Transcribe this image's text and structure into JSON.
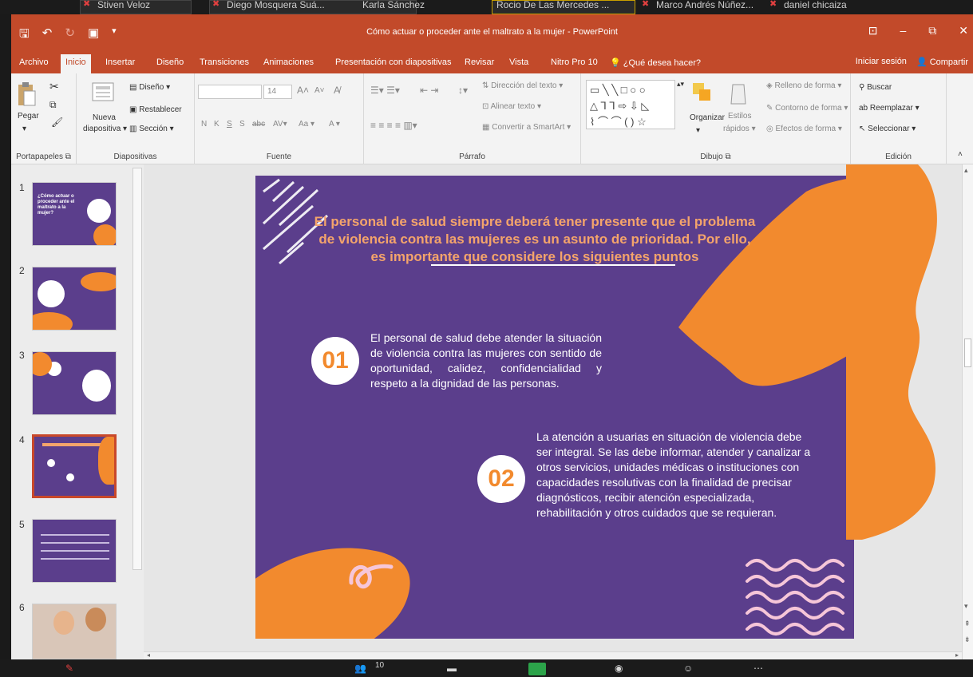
{
  "zoom": {
    "participants": [
      "Stiven Veloz",
      "Diego Mosquera Suá...",
      "Karla Sánchez",
      "Rocio De Las Mercedes ...",
      "Marco Andrés Núñez...",
      "daniel chicaiza"
    ],
    "participants_count": "10",
    "colors": {
      "bar": "#1b1b1b",
      "share": "#2ca44a"
    }
  },
  "window": {
    "title": "Cómo actuar o proceder ante el maltrato a la mujer - PowerPoint",
    "controls": [
      "⊡",
      "–",
      "⧉",
      "✕"
    ]
  },
  "tabs": [
    {
      "label": "Archivo"
    },
    {
      "label": "Inicio",
      "active": true
    },
    {
      "label": "Insertar"
    },
    {
      "label": "Diseño"
    },
    {
      "label": "Transiciones"
    },
    {
      "label": "Animaciones"
    },
    {
      "label": "Presentación con diapositivas"
    },
    {
      "label": "Revisar"
    },
    {
      "label": "Vista"
    },
    {
      "label": "Nitro Pro 10"
    },
    {
      "label": "¿Qué desea hacer?"
    }
  ],
  "account": {
    "signin": "Iniciar sesión",
    "share": "Compartir"
  },
  "ribbon": {
    "portapapeles": {
      "label": "Portapapeles",
      "paste": "Pegar"
    },
    "diapositivas": {
      "label": "Diapositivas",
      "new_slide_1": "Nueva",
      "new_slide_2": "diapositiva",
      "layout": "Diseño",
      "reset": "Restablecer",
      "section": "Sección"
    },
    "fuente": {
      "label": "Fuente",
      "size": "14",
      "bold": "N",
      "italic": "K",
      "underline": "S",
      "strike": "S",
      "spacing": "abc",
      "case": "Aa"
    },
    "parrafo": {
      "label": "Párrafo",
      "text_direction": "Dirección del texto",
      "align_text": "Alinear texto",
      "smartart": "Convertir a SmartArt"
    },
    "dibujo": {
      "label": "Dibujo",
      "arrange": "Organizar",
      "styles_1": "Estilos",
      "styles_2": "rápidos",
      "fill": "Relleno de forma",
      "outline": "Contorno de forma",
      "effects": "Efectos de forma"
    },
    "edicion": {
      "label": "Edición",
      "find": "Buscar",
      "replace": "Reemplazar",
      "select": "Seleccionar"
    }
  },
  "thumbnails": [
    {
      "num": "1",
      "text": "¿Cómo actuar o proceder ante el maltrato a la mujer?"
    },
    {
      "num": "2",
      "text": ""
    },
    {
      "num": "3",
      "text": ""
    },
    {
      "num": "4",
      "text": "",
      "selected": true
    },
    {
      "num": "5",
      "text": ""
    },
    {
      "num": "6",
      "text": ""
    }
  ],
  "slide": {
    "title": "El personal de salud siempre deberá tener presente que el problema de violencia contra las mujeres es un asunto de prioridad. Por ello, es importante que considere los siguientes puntos",
    "point1": {
      "num": "01",
      "text": "El personal de salud debe atender la situación de violencia contra las mujeres con sentido de oportunidad, calidez, confidencialidad y respeto a la dignidad de las personas."
    },
    "point2": {
      "num": "02",
      "text": "La atención a usuarias en situación de violencia debe ser integral. Se las debe informar, atender y canalizar a otros servicios, unidades médicas o instituciones con capacidades resolutivas con la finalidad de precisar diagnósticos, recibir atención especializada, rehabilitación y otros cuidados que se requieran."
    },
    "colors": {
      "background": "#5b3e8c",
      "accent": "#f28a2e",
      "title": "#f4a46b",
      "decor": "#f6c6d8"
    }
  }
}
